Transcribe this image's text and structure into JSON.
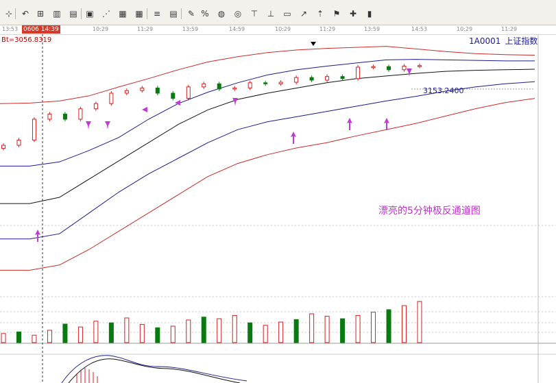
{
  "toolbar": {
    "icons": [
      "crosshair-icon",
      "undo-icon",
      "zoom-in-icon",
      "candle-icon",
      "bar-icon",
      "image-icon",
      "line-tool-icon",
      "grid-icon",
      "table-icon",
      "lines-icon",
      "data-grid-icon",
      "percent-pen-icon",
      "percent-icon",
      "palette-icon",
      "ring-icon",
      "text-icon",
      "histogram-icon",
      "fib-icon",
      "trend-icon",
      "arrow-up-icon",
      "flag-icon",
      "cross-tool-icon",
      "bars-tool-icon"
    ],
    "percent_label": "%"
  },
  "timebar": {
    "labels": [
      "13:53",
      "10:29",
      "11:29",
      "13:59",
      "14:59",
      "10:29",
      "11:29",
      "13:59",
      "14:53",
      "10:29",
      "11:29"
    ],
    "cursor_time": "0606 14:39"
  },
  "readout": "Bt=3056.8319",
  "index": {
    "code": "1A0001",
    "name": "上证指数"
  },
  "last_price": "3153.2400",
  "caption": "漂亮的5分钟极反通道图",
  "colors": {
    "up": "#d42020",
    "down": "#0a7a10",
    "outer_band": "#cc2a2a",
    "mid_band": "#1a1a8c",
    "ma": "#111111",
    "arrow": "#c23ad6",
    "grid": "#c8c8c8"
  },
  "chart_data": {
    "type": "candlestick",
    "title": "",
    "channels": {
      "upper_outer": [
        3080,
        3081,
        3085,
        3095,
        3112,
        3128,
        3145,
        3160,
        3170,
        3178,
        3183,
        3186,
        3188,
        3190,
        3185,
        3180,
        3176,
        3174,
        3173
      ],
      "upper_mid": [
        2960,
        2960,
        2968,
        2990,
        3015,
        3050,
        3080,
        3102,
        3120,
        3135,
        3145,
        3152,
        3158,
        3164,
        3165,
        3164,
        3163,
        3162,
        3162
      ],
      "middle": [
        2888,
        2888,
        2900,
        2935,
        2970,
        3005,
        3040,
        3068,
        3088,
        3100,
        3110,
        3120,
        3128,
        3133,
        3138,
        3142,
        3144,
        3145,
        3146
      ],
      "lower_mid": [
        2820,
        2820,
        2830,
        2870,
        2910,
        2945,
        2975,
        3005,
        3030,
        3045,
        3055,
        3065,
        3075,
        3085,
        3094,
        3104,
        3112,
        3118,
        3122
      ],
      "lower_outer": [
        2760,
        2760,
        2770,
        2800,
        2835,
        2870,
        2905,
        2940,
        2965,
        2982,
        2995,
        3005,
        3018,
        3030,
        3042,
        3056,
        3070,
        3082,
        3090
      ]
    },
    "candles": [
      3000,
      3010,
      3050,
      3060,
      3050,
      3070,
      3080,
      3100,
      3105,
      3110,
      3100,
      3090,
      3112,
      3118,
      3108,
      3110,
      3120,
      3118,
      3121,
      3130,
      3125,
      3132,
      3128,
      3150,
      3151,
      3145,
      3152,
      3153
    ],
    "volume": [
      22,
      26,
      18,
      30,
      45,
      38,
      52,
      48,
      60,
      44,
      36,
      40,
      55,
      62,
      58,
      66,
      48,
      42,
      50,
      56,
      70,
      64,
      58,
      66,
      74,
      80,
      90,
      100
    ],
    "xlabel": "",
    "ylabel": ""
  }
}
